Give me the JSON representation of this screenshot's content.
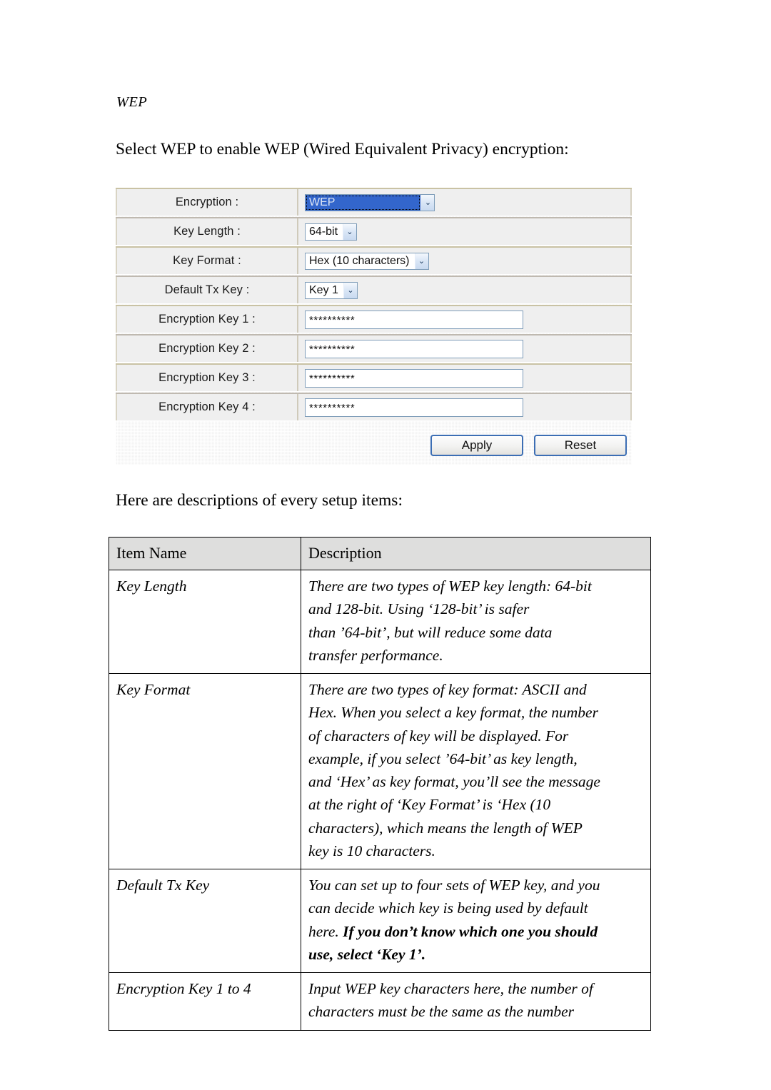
{
  "document": {
    "section_heading": "WEP",
    "intro_paragraph": "Select WEP to enable WEP (Wired Equivalent Privacy) encryption:",
    "table_lead_in": "Here are descriptions of every setup items:"
  },
  "router_form": {
    "rows": [
      {
        "label": "Encryption :",
        "control": "select",
        "value": "WEP",
        "focused": true
      },
      {
        "label": "Key Length :",
        "control": "select",
        "value": "64-bit",
        "focused": false
      },
      {
        "label": "Key Format :",
        "control": "select",
        "value": "Hex (10 characters)",
        "focused": false
      },
      {
        "label": "Default Tx Key :",
        "control": "select",
        "value": "Key 1",
        "focused": false
      },
      {
        "label": "Encryption Key 1 :",
        "control": "text",
        "value": "**********"
      },
      {
        "label": "Encryption Key 2 :",
        "control": "text",
        "value": "**********"
      },
      {
        "label": "Encryption Key 3 :",
        "control": "text",
        "value": "**********"
      },
      {
        "label": "Encryption Key 4 :",
        "control": "text",
        "value": "**********"
      }
    ],
    "buttons": {
      "apply_label": "Apply",
      "reset_label": "Reset"
    },
    "dropdown_arrow_glyph": "⌄",
    "colors": {
      "select_border": "#7f9db9",
      "button_border": "#3c6eb4",
      "selected_highlight": "#3366cc",
      "row_background": "#efefef"
    }
  },
  "description_table": {
    "headers": [
      "Item Name",
      "Description"
    ],
    "rows": [
      {
        "name": "Key Length",
        "lines": [
          "There are two types of WEP key length: 64-bit",
          "and 128-bit. Using ‘128-bit’ is safer",
          "than ’64-bit’, but will reduce some data",
          "transfer performance."
        ]
      },
      {
        "name": "Key Format",
        "lines": [
          "There are two types of key format: ASCII and",
          "Hex. When you select a key format, the number",
          "of characters of key will be displayed. For",
          "example, if you select ’64-bit’ as key length,",
          "and ‘Hex’ as key format, you’ll see the message",
          "at the right of ‘Key Format’ is ‘Hex (10",
          "characters), which means the length of WEP",
          "key is 10 characters."
        ]
      },
      {
        "name": "Default Tx Key",
        "lines": [
          "You can set up to four sets of WEP key, and you",
          "can decide which key is being used by default"
        ],
        "lines_mixed": [
          {
            "normal": "here. ",
            "bold": "If you don’t know which one you should"
          },
          {
            "normal": "",
            "bold": "use, select ‘Key 1’."
          }
        ]
      },
      {
        "name": "Encryption Key 1 to 4",
        "lines": [
          "Input WEP key characters here, the number of",
          "characters must be the same as the number"
        ]
      }
    ]
  }
}
